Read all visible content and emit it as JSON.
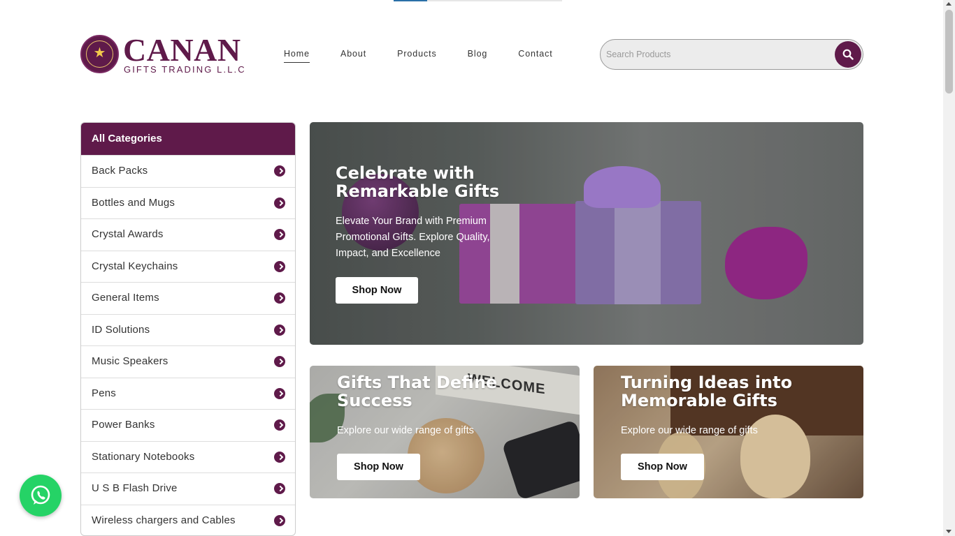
{
  "header": {
    "logo_word": "CANAN",
    "logo_sub": "GIFTS TRADING L.L.C",
    "nav": [
      {
        "label": "Home",
        "active": true
      },
      {
        "label": "About",
        "active": false
      },
      {
        "label": "Products",
        "active": false
      },
      {
        "label": "Blog",
        "active": false
      },
      {
        "label": "Contact",
        "active": false
      }
    ],
    "search": {
      "placeholder": "Search Products",
      "value": ""
    }
  },
  "sidebar": {
    "title": "All Categories",
    "items": [
      {
        "label": "Back Packs"
      },
      {
        "label": "Bottles and Mugs"
      },
      {
        "label": "Crystal Awards"
      },
      {
        "label": "Crystal Keychains"
      },
      {
        "label": "General Items"
      },
      {
        "label": "ID Solutions"
      },
      {
        "label": "Music Speakers"
      },
      {
        "label": "Pens"
      },
      {
        "label": "Power Banks"
      },
      {
        "label": "Stationary Notebooks"
      },
      {
        "label": "U S B Flash Drive"
      },
      {
        "label": "Wireless chargers and Cables"
      }
    ]
  },
  "hero": {
    "title": "Celebrate with Remarkable Gifts",
    "text": "Elevate Your Brand with Premium Promotional Gifts. Explore Quality, Impact, and Excellence",
    "button": "Shop Now"
  },
  "cards": [
    {
      "title": "Gifts That Define Success",
      "text": "Explore our wide range of gifts",
      "button": "Shop Now",
      "image_text": "WELCOME"
    },
    {
      "title": "Turning Ideas into Memorable Gifts",
      "text": "Explore our wide range of gifts",
      "button": "Shop Now"
    }
  ],
  "colors": {
    "brand": "#5f1a4a",
    "whatsapp": "#25d366"
  },
  "icons": {
    "search": "search-icon",
    "category_arrow": "chevron-right-circle-icon",
    "whatsapp": "whatsapp-icon"
  }
}
